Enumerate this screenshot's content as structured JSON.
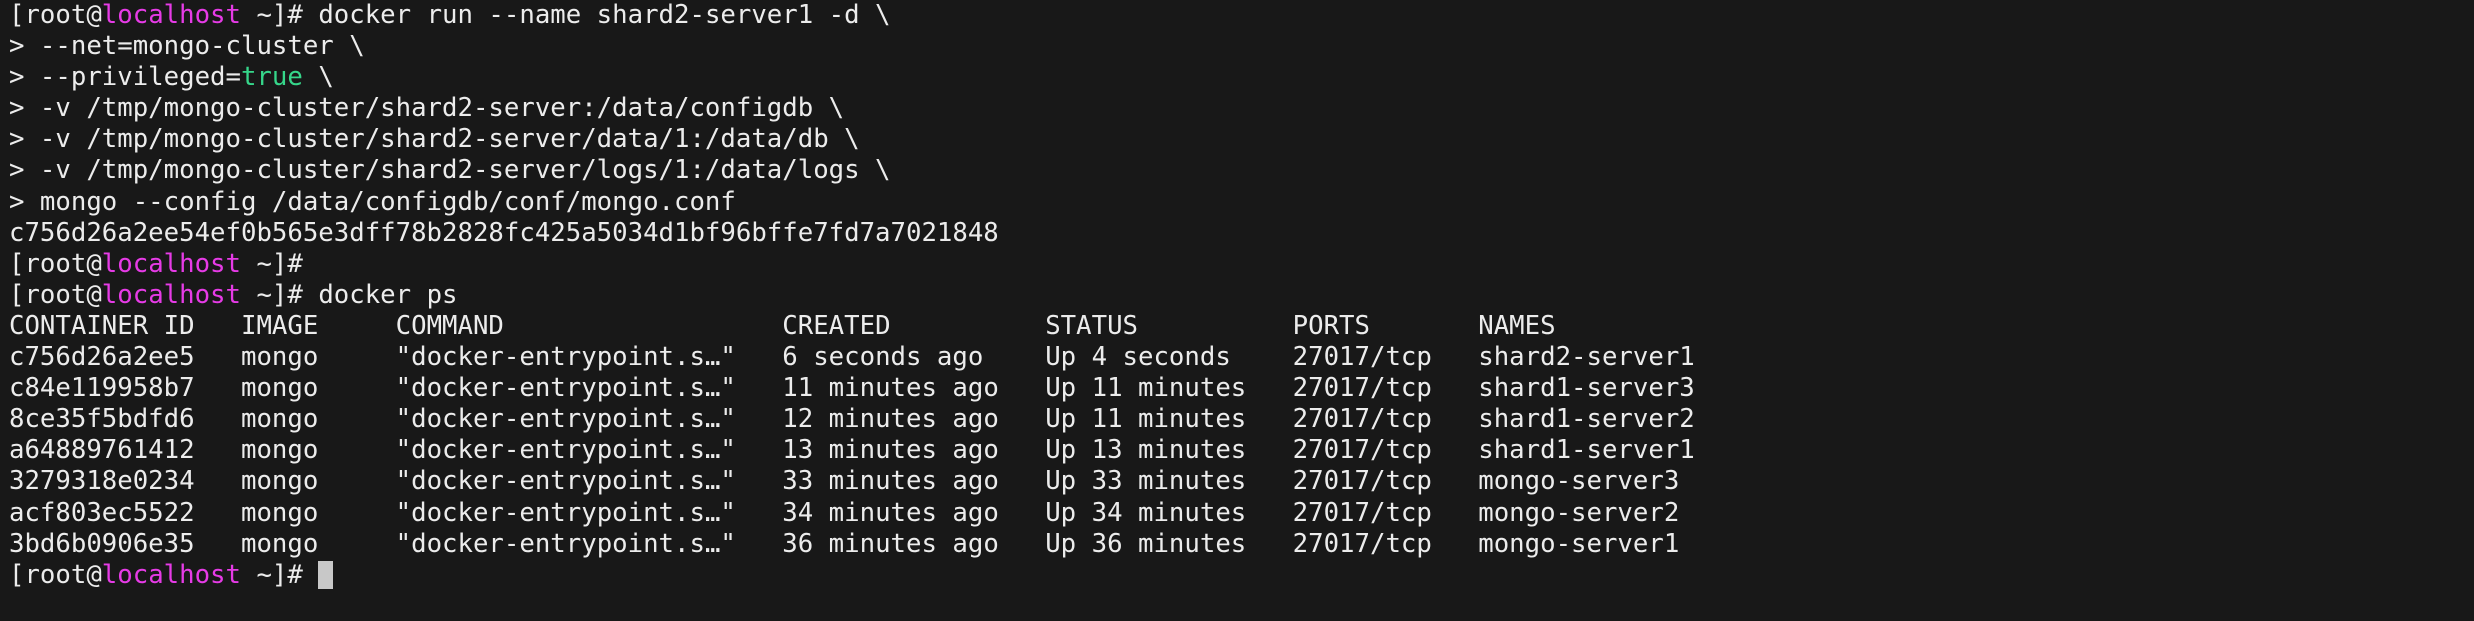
{
  "prompt": {
    "user_open": "[root@",
    "host": "localhost",
    "dir_close": " ~]# "
  },
  "session": {
    "command1": "docker run --name shard2-server1 -d \\",
    "cont1": "> --net=mongo-cluster \\",
    "cont2_prefix": "> --privileged=",
    "cont2_value": "true",
    "cont2_suffix": " \\",
    "cont3": "> -v /tmp/mongo-cluster/shard2-server:/data/configdb \\",
    "cont4": "> -v /tmp/mongo-cluster/shard2-server/data/1:/data/db \\",
    "cont5": "> -v /tmp/mongo-cluster/shard2-server/logs/1:/data/logs \\",
    "cont6": "> mongo --config /data/configdb/conf/mongo.conf",
    "container_hash": "c756d26a2ee54ef0b565e3dff78b2828fc425a5034d1bf96bffe7fd7a7021848",
    "command2": "docker ps"
  },
  "docker_ps": {
    "headers": [
      "CONTAINER ID",
      "IMAGE",
      "COMMAND",
      "CREATED",
      "STATUS",
      "PORTS",
      "NAMES"
    ],
    "rows": [
      [
        "c756d26a2ee5",
        "mongo",
        "\"docker-entrypoint.s…\"",
        "6 seconds ago",
        "Up 4 seconds",
        "27017/tcp",
        "shard2-server1"
      ],
      [
        "c84e119958b7",
        "mongo",
        "\"docker-entrypoint.s…\"",
        "11 minutes ago",
        "Up 11 minutes",
        "27017/tcp",
        "shard1-server3"
      ],
      [
        "8ce35f5bdfd6",
        "mongo",
        "\"docker-entrypoint.s…\"",
        "12 minutes ago",
        "Up 11 minutes",
        "27017/tcp",
        "shard1-server2"
      ],
      [
        "a64889761412",
        "mongo",
        "\"docker-entrypoint.s…\"",
        "13 minutes ago",
        "Up 13 minutes",
        "27017/tcp",
        "shard1-server1"
      ],
      [
        "3279318e0234",
        "mongo",
        "\"docker-entrypoint.s…\"",
        "33 minutes ago",
        "Up 33 minutes",
        "27017/tcp",
        "mongo-server3"
      ],
      [
        "acf803ec5522",
        "mongo",
        "\"docker-entrypoint.s…\"",
        "34 minutes ago",
        "Up 34 minutes",
        "27017/tcp",
        "mongo-server2"
      ],
      [
        "3bd6b0906e35",
        "mongo",
        "\"docker-entrypoint.s…\"",
        "36 minutes ago",
        "Up 36 minutes",
        "27017/tcp",
        "mongo-server1"
      ]
    ]
  },
  "colors": {
    "background": "#181818",
    "foreground": "#ececec",
    "hostname": "#e63be6",
    "keyword_true": "#36d68a",
    "cursor": "#c8c8c8"
  }
}
